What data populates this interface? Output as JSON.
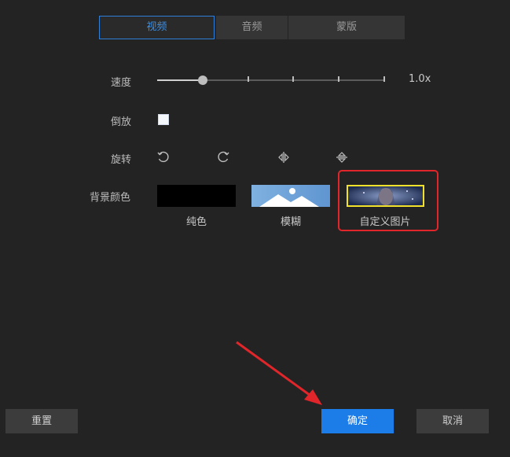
{
  "tabs": [
    {
      "label": "视频",
      "active": true
    },
    {
      "label": "音频",
      "active": false
    },
    {
      "label": "蒙版",
      "active": false
    }
  ],
  "speed": {
    "label": "速度",
    "value_text": "1.0x",
    "slider_fraction": 0.2,
    "ticks": 5
  },
  "reverse": {
    "label": "倒放",
    "checked": false
  },
  "rotate": {
    "label": "旋转",
    "icons": [
      "rotate-ccw-icon",
      "rotate-cw-icon",
      "flip-horizontal-icon",
      "flip-vertical-icon"
    ]
  },
  "background": {
    "label": "背景颜色",
    "options": [
      {
        "caption": "纯色",
        "kind": "solid"
      },
      {
        "caption": "模糊",
        "kind": "blur"
      },
      {
        "caption": "自定义图片",
        "kind": "custom",
        "selected": true
      }
    ]
  },
  "buttons": {
    "reset": "重置",
    "confirm": "确定",
    "cancel": "取消"
  },
  "colors": {
    "accent": "#1c7ce8",
    "highlight": "#e0262a",
    "selected_border": "#f2e12b"
  }
}
